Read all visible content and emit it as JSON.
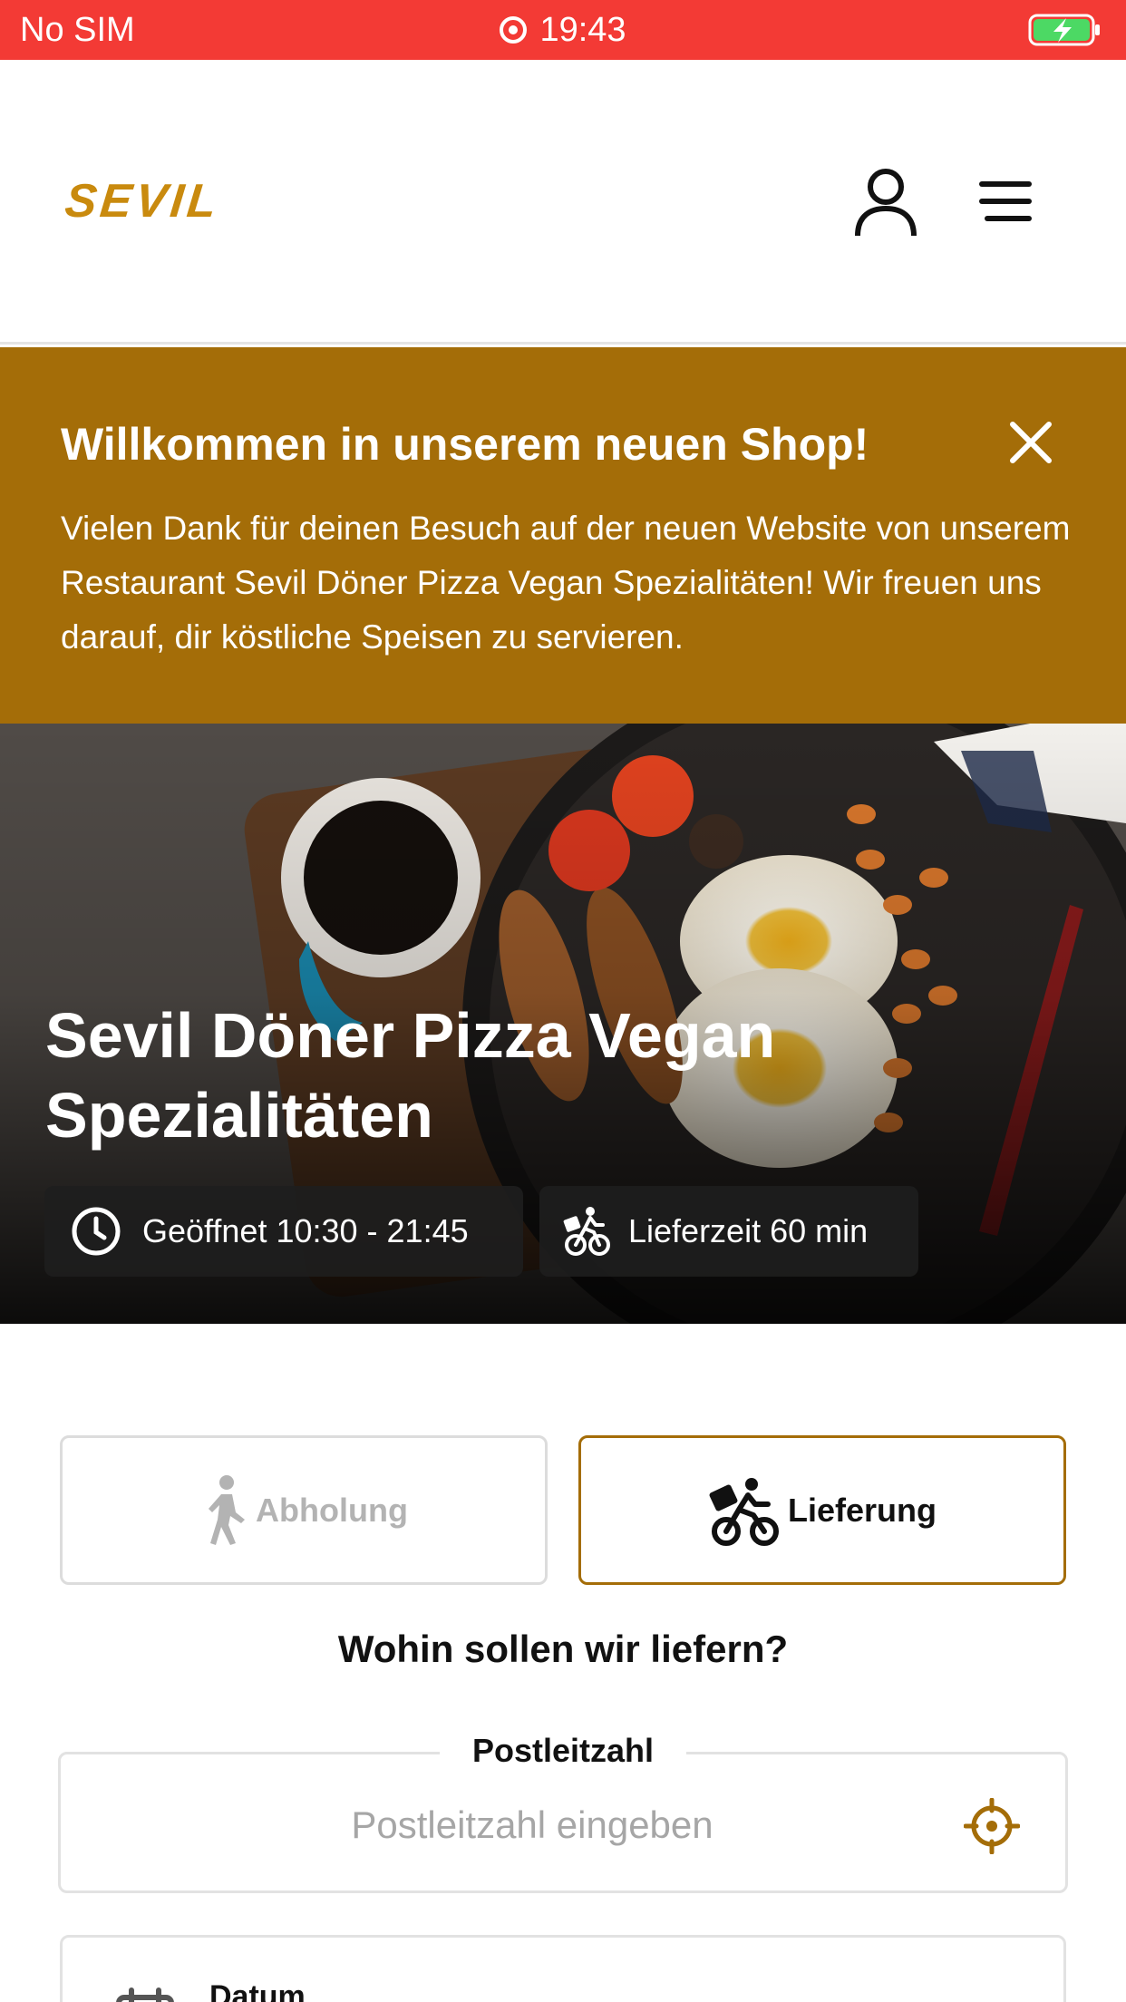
{
  "status_bar": {
    "carrier": "No SIM",
    "time": "19:43",
    "icons": [
      "screen-record-icon",
      "battery-charging-icon"
    ]
  },
  "header": {
    "logo_text": "SEVIL",
    "icons": [
      "account-icon",
      "menu-icon"
    ]
  },
  "banner": {
    "title": "Willkommen in unserem neuen Shop!",
    "text": "Vielen Dank für deinen Besuch auf der neuen Website von unserem Restaurant Sevil Döner Pizza Vegan Spezialitäten! Wir freuen uns darauf, dir köstliche Speisen zu servieren.",
    "background": "#a46d08"
  },
  "hero": {
    "title": "Sevil Döner Pizza Vegan Spezialitäten",
    "opening_hours": "Geöffnet 10:30 - 21:45",
    "delivery_time": "Lieferzeit 60 min"
  },
  "order_mode": {
    "pickup_label": "Abholung",
    "delivery_label": "Lieferung",
    "selected": "delivery"
  },
  "delivery_form": {
    "question": "Wohin sollen wir liefern?",
    "postal_label": "Postleitzahl",
    "postal_placeholder": "Postleitzahl eingeben",
    "postal_value": "",
    "date_label": "Datum"
  },
  "colors": {
    "status_bar": "#f33a35",
    "accent": "#a46d08",
    "logo": "#c98a0e"
  }
}
